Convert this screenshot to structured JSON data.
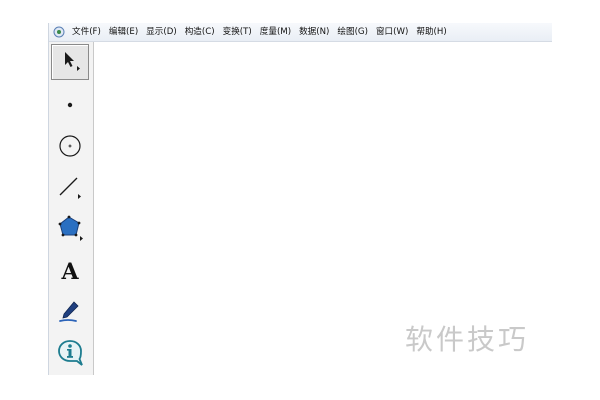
{
  "menubar": {
    "app_icon": "sketchpad-app-icon",
    "items": [
      {
        "label": "文件(F)"
      },
      {
        "label": "编辑(E)"
      },
      {
        "label": "显示(D)"
      },
      {
        "label": "构造(C)"
      },
      {
        "label": "变换(T)"
      },
      {
        "label": "度量(M)"
      },
      {
        "label": "数据(N)"
      },
      {
        "label": "绘图(G)"
      },
      {
        "label": "窗口(W)"
      },
      {
        "label": "帮助(H)"
      }
    ]
  },
  "toolbox": {
    "tools": [
      {
        "name": "selection-arrow-tool",
        "icon": "arrow-icon",
        "selected": true
      },
      {
        "name": "point-tool",
        "icon": "point-icon",
        "selected": false
      },
      {
        "name": "compass-tool",
        "icon": "circle-icon",
        "selected": false
      },
      {
        "name": "straightedge-tool",
        "icon": "line-icon",
        "selected": false
      },
      {
        "name": "polygon-tool",
        "icon": "polygon-icon",
        "selected": false
      },
      {
        "name": "text-tool",
        "icon": "text-icon",
        "label": "A",
        "selected": false
      },
      {
        "name": "marker-tool",
        "icon": "marker-pen-icon",
        "selected": false
      },
      {
        "name": "information-tool",
        "icon": "info-icon",
        "selected": false
      }
    ]
  },
  "watermark": {
    "text": "软件技巧"
  },
  "colors": {
    "menubar_bg": "#eef2f8",
    "toolbox_bg": "#f3f3f3",
    "polygon_fill": "#2a6fc1",
    "marker_blue": "#2b63b8",
    "info_teal": "#1d7c8f",
    "watermark": "#c9c9c9"
  }
}
